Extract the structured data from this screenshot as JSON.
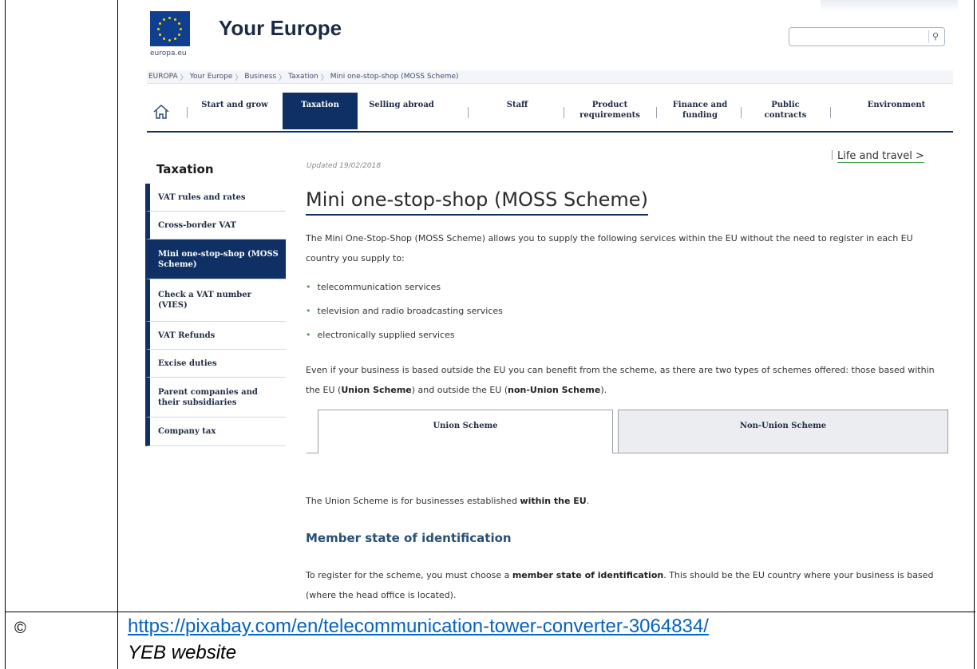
{
  "header": {
    "site_title": "Your Europe",
    "eu_domain": "europa.eu",
    "search": {
      "value": "",
      "placeholder": ""
    }
  },
  "breadcrumb": [
    "EUROPA",
    "Your Europe",
    "Business",
    "Taxation",
    "Mini one-stop-shop (MOSS Scheme)"
  ],
  "nav": {
    "items": [
      {
        "label": "Start and grow",
        "active": false
      },
      {
        "label": "Taxation",
        "active": true
      },
      {
        "label": "Selling abroad",
        "active": false
      },
      {
        "label": "Staff",
        "active": false
      },
      {
        "label": "Product requirements",
        "active": false
      },
      {
        "label": "Finance and funding",
        "active": false
      },
      {
        "label": "Public contracts",
        "active": false
      },
      {
        "label": "Environment",
        "active": false
      }
    ]
  },
  "sidebar": {
    "title": "Taxation",
    "items": [
      {
        "label": "VAT rules and rates",
        "active": false
      },
      {
        "label": "Cross-border VAT",
        "active": false
      },
      {
        "label": "Mini one-stop-shop (MOSS Scheme)",
        "active": true
      },
      {
        "label": "Check a VAT number (VIES)",
        "active": false
      },
      {
        "label": "VAT Refunds",
        "active": false
      },
      {
        "label": "Excise duties",
        "active": false
      },
      {
        "label": "Parent companies and their subsidiaries",
        "active": false
      },
      {
        "label": "Company tax",
        "active": false
      }
    ]
  },
  "content": {
    "life_link": "Life and travel >",
    "updated": "Updated 19/02/2018",
    "title": "Mini one-stop-shop (MOSS Scheme)",
    "intro": "The Mini One-Stop-Shop (MOSS Scheme) allows you to supply the following services within the EU without the need to register in each EU country you supply to:",
    "bullets": [
      "telecommunication services",
      "television and radio broadcasting services",
      "electronically supplied services"
    ],
    "para2_a": "Even if your business is based outside the EU you can benefit from the scheme, as there are two types of schemes offered: those based within the EU (",
    "para2_b": "Union Scheme",
    "para2_c": ") and outside the EU (",
    "para2_d": "non-Union Scheme",
    "para2_e": ").",
    "tabs": [
      "Union Scheme",
      "Non-Union Scheme"
    ],
    "union_a": "The Union Scheme is for businesses established ",
    "union_b": "within the EU",
    "union_c": ".",
    "subheading": "Member state of identification",
    "register_a": "To register for the scheme, you must choose a ",
    "register_b": "member state of identification",
    "register_c": ". This should be the EU country where your business is based (where the head office is located)."
  },
  "document": {
    "copyright_symbol": "©",
    "source_url": "https://pixabay.com/en/telecommunication-tower-converter-3064834/",
    "credit": "YEB website"
  }
}
